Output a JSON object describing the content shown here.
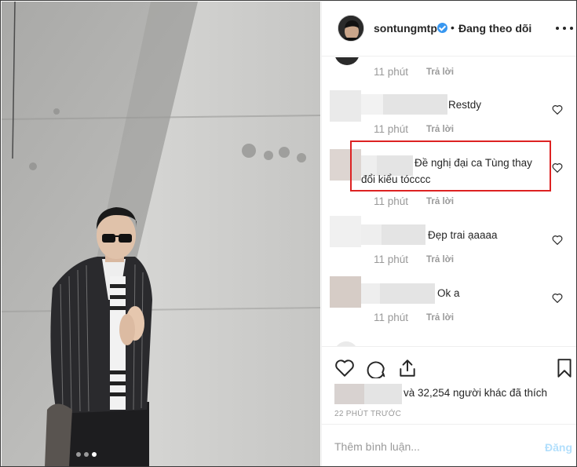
{
  "header": {
    "username": "sontungmtp",
    "separator": "•",
    "follow_status": "Đang theo dõi",
    "verified_icon": "verified-badge-icon",
    "more_icon": "more-options-icon"
  },
  "comments": [
    {
      "text": "",
      "time": "11 phút",
      "reply": "Trả lời"
    },
    {
      "text": "Restdy",
      "time": "11 phút",
      "reply": "Trả lời"
    },
    {
      "text_line1": "Đề nghị đại ca Tùng thay",
      "text_line2": "đổi kiểu tócccc",
      "time": "11 phút",
      "reply": "Trả lời"
    },
    {
      "text": "Đẹp trai ạaaaa",
      "time": "11 phút",
      "reply": "Trả lời"
    },
    {
      "text": "Ok a",
      "time": "11 phút",
      "reply": "Trả lời"
    }
  ],
  "actions": {
    "like_icon": "heart-icon",
    "comment_icon": "comment-icon",
    "share_icon": "share-icon",
    "save_icon": "bookmark-icon"
  },
  "likes": {
    "text": "và 32,254 người khác đã thích"
  },
  "timestamp": "22 PHÚT TRƯỚC",
  "add_comment": {
    "placeholder": "Thêm bình luận...",
    "post_label": "Đăng"
  },
  "colors": {
    "accent_blue": "#3897f0",
    "post_button_disabled": "#b2dffc",
    "highlight_red": "#dd2222"
  },
  "carousel": {
    "count": 3,
    "active": 3
  }
}
